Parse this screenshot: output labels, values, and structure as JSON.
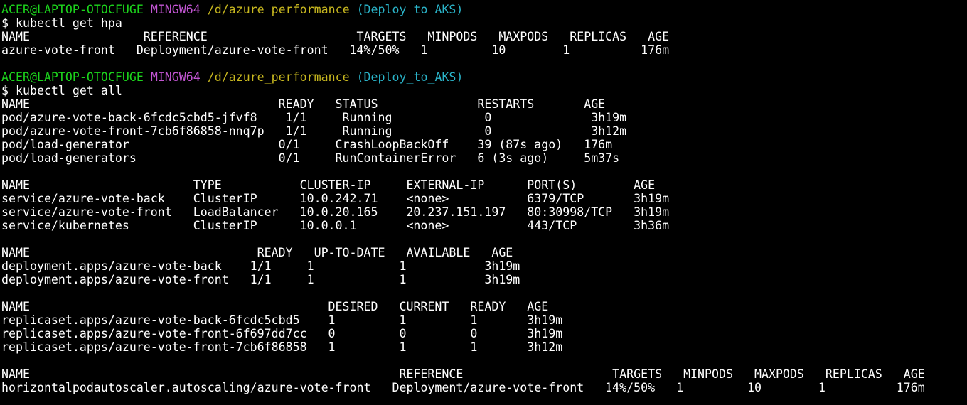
{
  "colors": {
    "background": "#000000",
    "text": "#ffffff",
    "prompt_user": "#1cd41c",
    "prompt_shell": "#c255d2",
    "prompt_path": "#c7b71f",
    "prompt_branch": "#2ab3c8"
  },
  "terminal": {
    "prompt": {
      "user_host": "ACER@LAPTOP-OTOCFUGE",
      "shell": "MINGW64",
      "path": "/d/azure_performance",
      "branch": "(Deploy_to_AKS)"
    },
    "lines": [
      {
        "kind": "prompt"
      },
      {
        "kind": "cmd",
        "text": "$ kubectl get hpa"
      },
      {
        "kind": "out",
        "text": "NAME                REFERENCE                     TARGETS   MINPODS   MAXPODS   REPLICAS   AGE"
      },
      {
        "kind": "out",
        "text": "azure-vote-front   Deployment/azure-vote-front   14%/50%   1         10        1          176m"
      },
      {
        "kind": "blank",
        "text": ""
      },
      {
        "kind": "prompt"
      },
      {
        "kind": "cmd",
        "text": "$ kubectl get all"
      },
      {
        "kind": "out",
        "text": "NAME                                   READY   STATUS              RESTARTS       AGE"
      },
      {
        "kind": "out",
        "text": "pod/azure-vote-back-6fcdc5cbd5-jfvf8    1/1     Running             0              3h19m"
      },
      {
        "kind": "out",
        "text": "pod/azure-vote-front-7cb6f86858-nnq7p   1/1     Running             0              3h12m"
      },
      {
        "kind": "out",
        "text": "pod/load-generator                     0/1     CrashLoopBackOff    39 (87s ago)   176m"
      },
      {
        "kind": "out",
        "text": "pod/load-generators                    0/1     RunContainerError   6 (3s ago)     5m37s"
      },
      {
        "kind": "blank",
        "text": ""
      },
      {
        "kind": "out",
        "text": "NAME                       TYPE           CLUSTER-IP     EXTERNAL-IP      PORT(S)        AGE"
      },
      {
        "kind": "out",
        "text": "service/azure-vote-back    ClusterIP      10.0.242.71    <none>           6379/TCP       3h19m"
      },
      {
        "kind": "out",
        "text": "service/azure-vote-front   LoadBalancer   10.0.20.165    20.237.151.197   80:30998/TCP   3h19m"
      },
      {
        "kind": "out",
        "text": "service/kubernetes         ClusterIP      10.0.0.1       <none>           443/TCP        3h36m"
      },
      {
        "kind": "blank",
        "text": ""
      },
      {
        "kind": "out",
        "text": "NAME                                READY   UP-TO-DATE   AVAILABLE   AGE"
      },
      {
        "kind": "out",
        "text": "deployment.apps/azure-vote-back    1/1     1            1           3h19m"
      },
      {
        "kind": "out",
        "text": "deployment.apps/azure-vote-front   1/1     1            1           3h19m"
      },
      {
        "kind": "blank",
        "text": ""
      },
      {
        "kind": "out",
        "text": "NAME                                          DESIRED   CURRENT   READY   AGE"
      },
      {
        "kind": "out",
        "text": "replicaset.apps/azure-vote-back-6fcdc5cbd5    1         1         1       3h19m"
      },
      {
        "kind": "out",
        "text": "replicaset.apps/azure-vote-front-6f697dd7cc   0         0         0       3h19m"
      },
      {
        "kind": "out",
        "text": "replicaset.apps/azure-vote-front-7cb6f86858   1         1         1       3h12m"
      },
      {
        "kind": "blank",
        "text": ""
      },
      {
        "kind": "out",
        "text": "NAME                                                    REFERENCE                     TARGETS   MINPODS   MAXPODS   REPLICAS   AGE"
      },
      {
        "kind": "out",
        "text": "horizontalpodautoscaler.autoscaling/azure-vote-front   Deployment/azure-vote-front   14%/50%   1         10        1          176m"
      }
    ]
  }
}
